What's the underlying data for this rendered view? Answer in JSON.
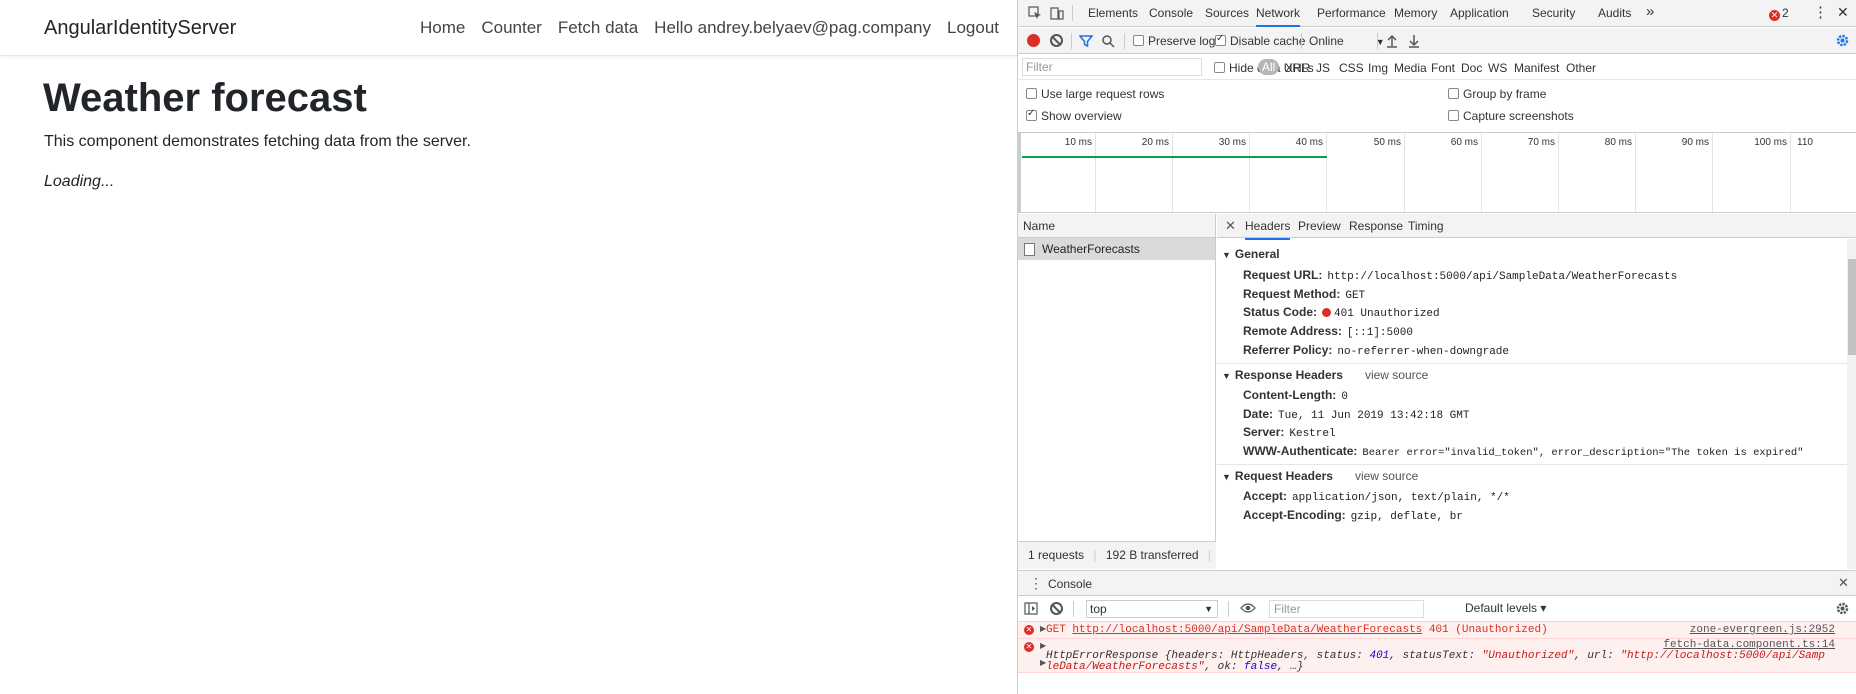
{
  "app": {
    "brand": "AngularIdentityServer",
    "nav": [
      "Home",
      "Counter",
      "Fetch data",
      "Hello andrey.belyaev@pag.company",
      "Logout"
    ],
    "title": "Weather forecast",
    "description": "This component demonstrates fetching data from the server.",
    "loading": "Loading..."
  },
  "devtools": {
    "tabs": [
      "Elements",
      "Console",
      "Sources",
      "Network",
      "Performance",
      "Memory",
      "Application",
      "Security",
      "Audits"
    ],
    "active_tab": "Network",
    "more_tabs": "»",
    "error_count": "2",
    "kebab": "⋮",
    "close": "✕",
    "toolbar": {
      "preserve_log": "Preserve log",
      "disable_cache": "Disable cache",
      "throttling": "Online",
      "throttling_arrow": "▼"
    },
    "filter": {
      "placeholder": "Filter",
      "hide_data_urls": "Hide data URLs",
      "types": [
        "All",
        "XHR",
        "JS",
        "CSS",
        "Img",
        "Media",
        "Font",
        "Doc",
        "WS",
        "Manifest",
        "Other"
      ]
    },
    "options": {
      "large_rows": "Use large request rows",
      "show_overview": "Show overview",
      "group_by_frame": "Group by frame",
      "capture_screenshots": "Capture screenshots"
    },
    "overview_ticks": [
      "10 ms",
      "20 ms",
      "30 ms",
      "40 ms",
      "50 ms",
      "60 ms",
      "70 ms",
      "80 ms",
      "90 ms",
      "100 ms",
      "110"
    ],
    "requests": {
      "name_header": "Name",
      "rows": [
        "WeatherForecasts"
      ],
      "summary_count": "1 requests",
      "summary_transferred": "192 B transferred",
      "summary_more": "("
    },
    "details": {
      "close": "✕",
      "tabs": [
        "Headers",
        "Preview",
        "Response",
        "Timing"
      ],
      "general_title": "General",
      "general": [
        {
          "k": "Request URL:",
          "v": "http://localhost:5000/api/SampleData/WeatherForecasts"
        },
        {
          "k": "Request Method:",
          "v": "GET"
        },
        {
          "k": "Status Code:",
          "v": "401 Unauthorized"
        },
        {
          "k": "Remote Address:",
          "v": "[::1]:5000"
        },
        {
          "k": "Referrer Policy:",
          "v": "no-referrer-when-downgrade"
        }
      ],
      "response_title": "Response Headers",
      "view_source": "view source",
      "response": [
        {
          "k": "Content-Length:",
          "v": "0"
        },
        {
          "k": "Date:",
          "v": "Tue, 11 Jun 2019 13:42:18 GMT"
        },
        {
          "k": "Server:",
          "v": "Kestrel"
        },
        {
          "k": "WWW-Authenticate:",
          "v": "Bearer error=\"invalid_token\", error_description=\"The token is expired\""
        }
      ],
      "request_title": "Request Headers",
      "request": [
        {
          "k": "Accept:",
          "v": "application/json, text/plain, */*"
        },
        {
          "k": "Accept-Encoding:",
          "v": "gzip, deflate, br"
        }
      ]
    },
    "console": {
      "tab": "Console",
      "context": "top",
      "context_arrow": "▼",
      "filter_placeholder": "Filter",
      "levels": "Default levels ▾",
      "msg1": {
        "method": "GET",
        "url": "http://localhost:5000/api/SampleData/WeatherForecasts",
        "status": "401 (Unauthorized)",
        "source": "zone-evergreen.js:2952"
      },
      "msg2": {
        "source": "fetch-data.component.ts:14",
        "class_name": "HttpErrorResponse",
        "text_a": "{headers: HttpHeaders, status: ",
        "status": "401",
        "text_b": ", statusText: ",
        "status_text": "\"Unauthorized\"",
        "text_c": ", url: ",
        "url_line1": "\"http://localhost:5000/api/Samp",
        "url_line2": "leData/WeatherForecasts\"",
        "text_d": ", ok: ",
        "ok": "false",
        "text_e": ", …}"
      }
    }
  }
}
